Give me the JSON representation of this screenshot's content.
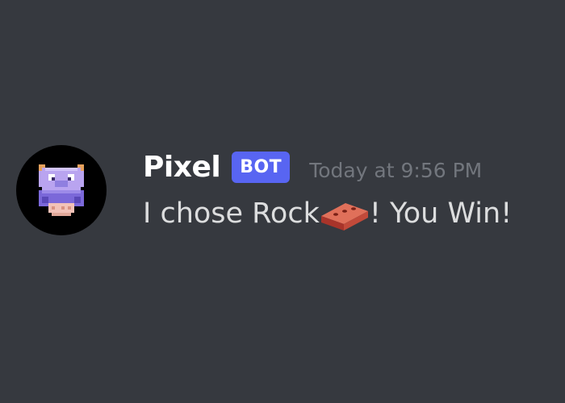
{
  "message": {
    "username": "Pixel",
    "badge": "BOT",
    "timestamp": "Today at 9:56 PM",
    "text_before": "I chose Rock",
    "text_after": "! You Win!",
    "emoji": "brick-icon",
    "avatar": "pixel-creature-avatar"
  },
  "colors": {
    "background": "#36393f",
    "username": "#ffffff",
    "badge": "#5865f2",
    "timestamp": "#72767d",
    "message_text": "#dcddde"
  }
}
